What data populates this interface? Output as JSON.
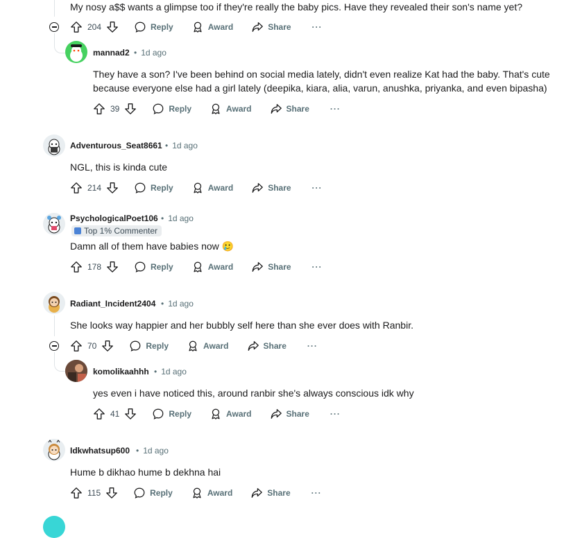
{
  "labels": {
    "reply": "Reply",
    "award": "Award",
    "share": "Share",
    "more": "···",
    "dot": "•"
  },
  "comments": [
    {
      "author": "",
      "time": "",
      "body": "My nosy a$$ wants a glimpse too if they're really the baby pics. Have they revealed their son's name yet?",
      "votes": "204"
    },
    {
      "author": "mannad2",
      "time": "1d ago",
      "body": "They have a son? I've been behind on social media lately, didn't even realize Kat had the baby. That's cute because everyone else had a girl lately (deepika, kiara, alia, varun, anushka, priyanka, and even bipasha)",
      "votes": "39"
    },
    {
      "author": "Adventurous_Seat8661",
      "time": "1d ago",
      "body": "NGL, this is kinda cute",
      "votes": "214"
    },
    {
      "author": "PsychologicalPoet106",
      "time": "1d ago",
      "flair": "Top 1% Commenter",
      "body": "Damn all of them have babies now 🥲",
      "votes": "178"
    },
    {
      "author": "Radiant_Incident2404",
      "time": "1d ago",
      "body": "She looks way happier and her bubbly self here than she ever does with Ranbir.",
      "votes": "70"
    },
    {
      "author": "komolikaahhh",
      "time": "1d ago",
      "body": "yes even i have noticed this, around ranbir she's always conscious idk why",
      "votes": "41"
    },
    {
      "author": "Idkwhatsup600",
      "time": "1d ago",
      "body": "Hume b dikhao hume b dekhna hai",
      "votes": "115"
    }
  ],
  "colors": {
    "text": "#1a1a1b",
    "meta": "#576f76",
    "thread": "#dfe3e6",
    "flair_bg": "#eaedef"
  }
}
